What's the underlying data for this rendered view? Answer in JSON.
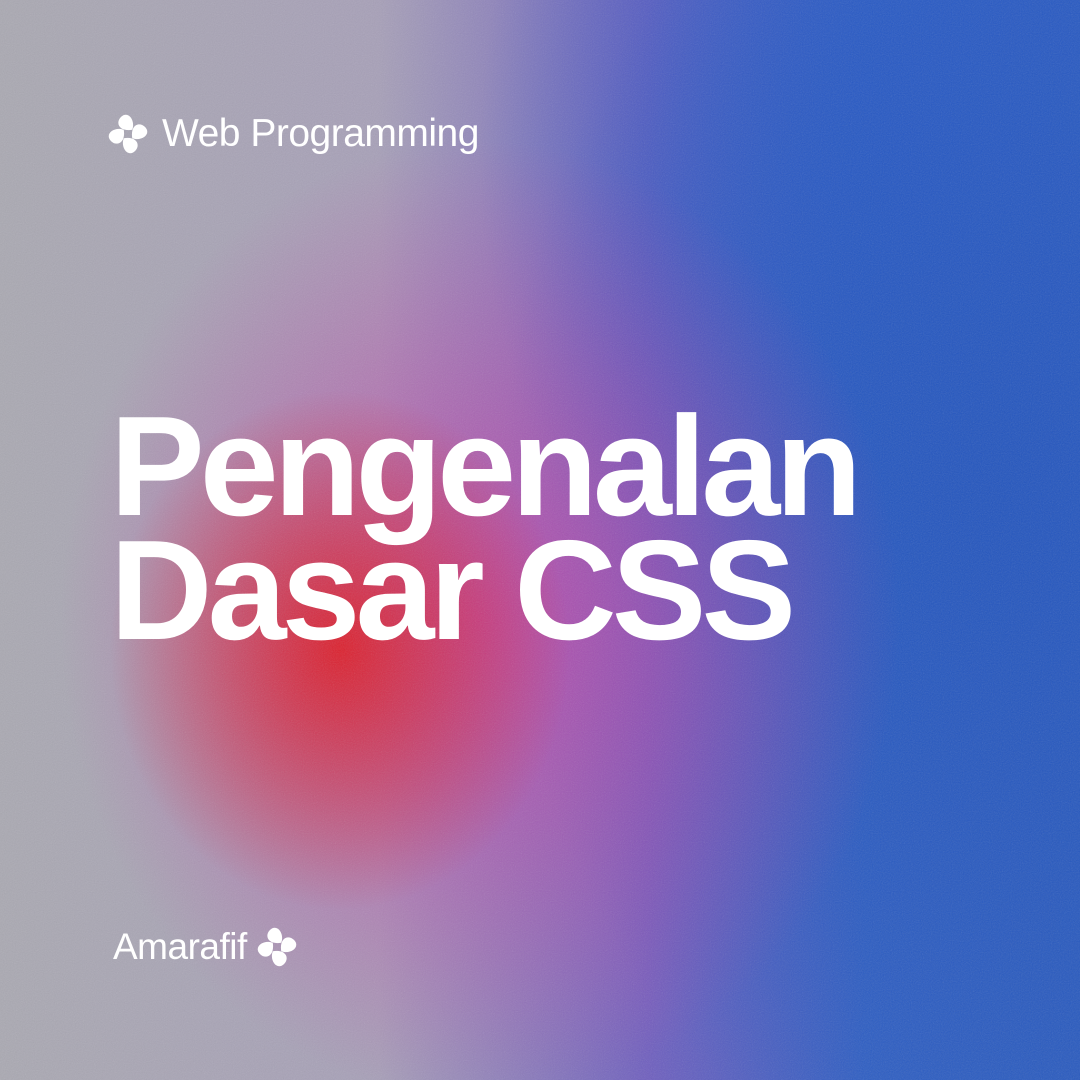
{
  "header": {
    "category": "Web Programming",
    "icon": "clover-icon"
  },
  "title": {
    "line1": "Pengenalan",
    "line2": "Dasar CSS"
  },
  "footer": {
    "author": "Amarafif",
    "icon": "clover-icon"
  },
  "colors": {
    "text": "#ffffff",
    "left": "#aaa9b2",
    "center": "#de1e28",
    "mid": "#be46aa",
    "right": "#2a5bbf"
  }
}
